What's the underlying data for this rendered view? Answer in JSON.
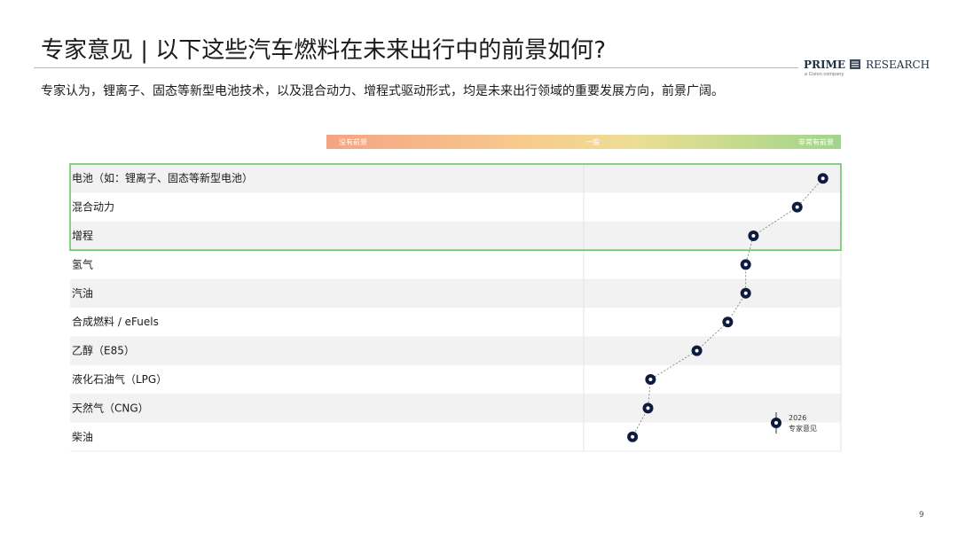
{
  "title": "专家意见 | 以下这些汽车燃料在未来出行中的前景如何?",
  "subtitle": "专家认为，锂离子、固态等新型电池技术，以及混合动力、增程式驱动形式，均是未来出行领域的重要发展方向，前景广阔。",
  "logo": {
    "prime": "PRIME",
    "research": "RESEARCH",
    "sub": "a Cision company"
  },
  "scale": {
    "left": "没有前景",
    "mid": "一般",
    "right": "非常有前景"
  },
  "legend": {
    "year": "2026",
    "label": "专家意见"
  },
  "page_number": "9",
  "colors": {
    "marker": "#0d1b3e",
    "highlight_border": "#6cc46c",
    "row_band": "#f2f2f2"
  },
  "chart_data": {
    "type": "scatter",
    "categories": [
      "电池（如：锂离子、固态等新型电池）",
      "混合动力",
      "增程",
      "氢气",
      "汽油",
      "合成燃料 / eFuels",
      "乙醇（E85）",
      "液化石油气（LPG）",
      "天然气（CNG）",
      "柴油"
    ],
    "series": [
      {
        "name": "专家意见",
        "values": [
          4.86,
          4.66,
          4.32,
          4.26,
          4.26,
          4.12,
          3.88,
          3.52,
          3.5,
          3.38
        ]
      }
    ],
    "xlim": [
      1,
      5
    ],
    "highlighted_categories": [
      0,
      1,
      2
    ]
  }
}
